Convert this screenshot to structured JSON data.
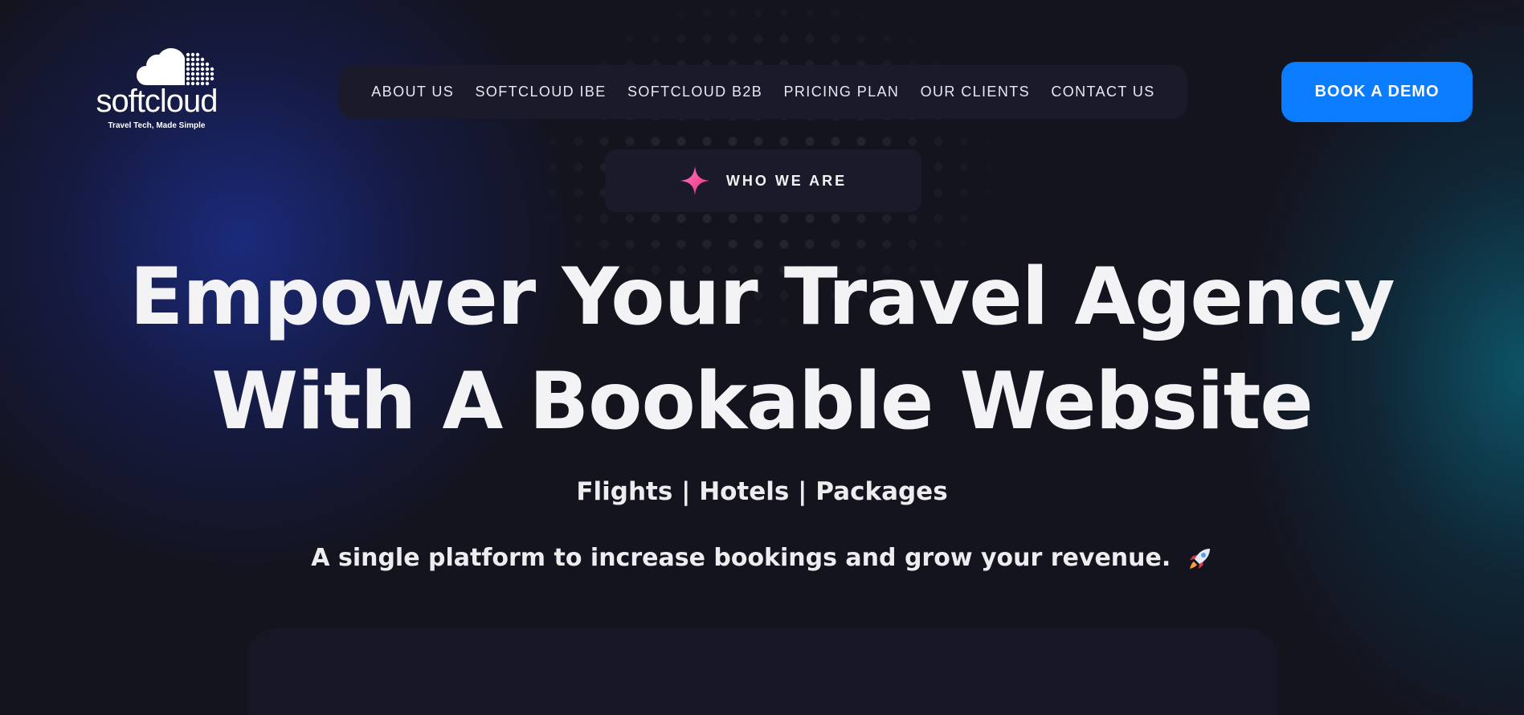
{
  "logo": {
    "name": "softcloud",
    "tagline": "Travel Tech, Made Simple",
    "icon": "cloud-icon"
  },
  "nav": {
    "items": [
      {
        "label": "ABOUT US"
      },
      {
        "label": "SOFTCLOUD IBE"
      },
      {
        "label": "SOFTCLOUD B2B"
      },
      {
        "label": "PRICING PLAN"
      },
      {
        "label": "OUR CLIENTS"
      },
      {
        "label": "CONTACT US"
      }
    ]
  },
  "cta": {
    "label": "BOOK A DEMO",
    "color": "#0a7cff"
  },
  "badge": {
    "label": "WHO WE ARE",
    "icon": "sparkle-icon",
    "icon_color": "#ff4fb0"
  },
  "hero": {
    "title_line1": "Empower Your Travel Agency",
    "title_line2": "With A Bookable Website",
    "subtitle": "Flights | Hotels | Packages",
    "description": "A single platform to increase bookings and grow your revenue.",
    "description_icon": "rocket-icon"
  },
  "colors": {
    "background": "#14141f",
    "glow_left": "#1c2e8c",
    "glow_right": "#0c5a6e"
  }
}
